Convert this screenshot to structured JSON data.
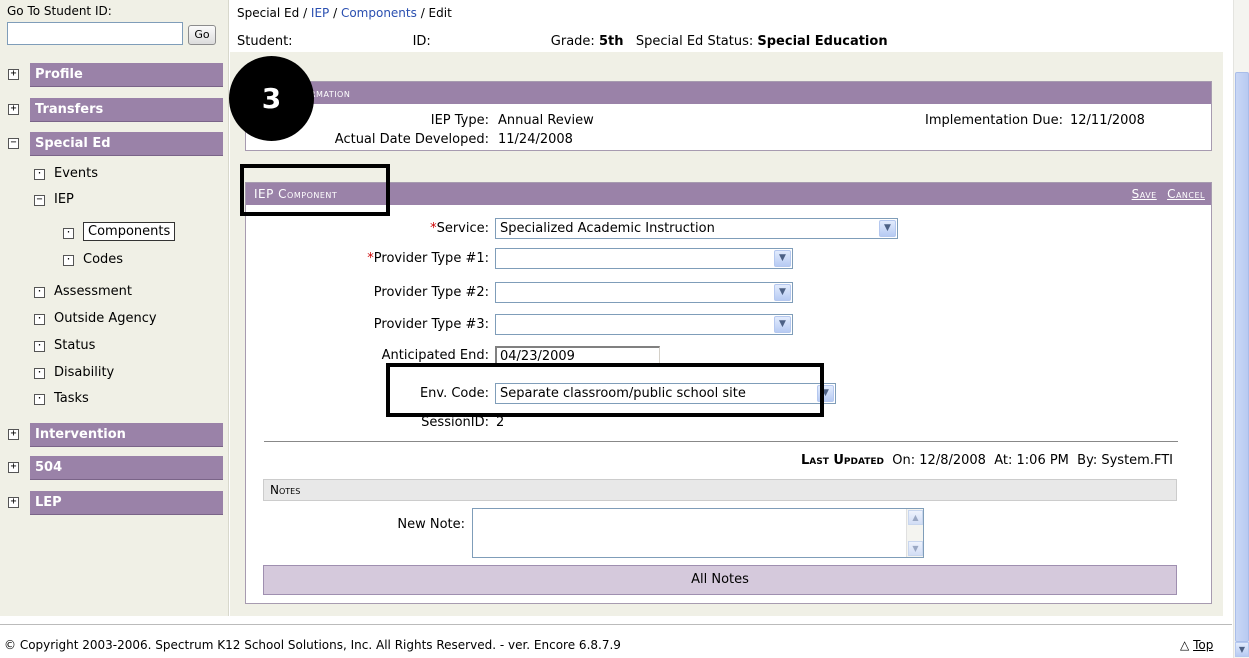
{
  "sidebar": {
    "goto_label": "Go To Student ID:",
    "goto_value": "",
    "go_button": "Go",
    "sections": [
      {
        "label": "Profile",
        "toggle": "+"
      },
      {
        "label": "Transfers",
        "toggle": "+"
      },
      {
        "label": "Special Ed",
        "toggle": "−"
      },
      {
        "label": "Intervention",
        "toggle": "+"
      },
      {
        "label": "504",
        "toggle": "+"
      },
      {
        "label": "LEP",
        "toggle": "+"
      }
    ],
    "special_ed_items": [
      {
        "label": "Events",
        "toggle": "·"
      },
      {
        "label": "IEP",
        "toggle": "−"
      },
      {
        "label": "Components",
        "toggle": "·"
      },
      {
        "label": "Codes",
        "toggle": "·"
      },
      {
        "label": "Assessment",
        "toggle": "·"
      },
      {
        "label": "Outside Agency",
        "toggle": "·"
      },
      {
        "label": "Status",
        "toggle": "·"
      },
      {
        "label": "Disability",
        "toggle": "·"
      },
      {
        "label": "Tasks",
        "toggle": "·"
      }
    ]
  },
  "breadcrumb": {
    "part1": "Special Ed",
    "sep": " / ",
    "part2": "IEP",
    "part3": "Components",
    "part4": "Edit"
  },
  "student": {
    "student_label": "Student:",
    "id_label": "ID:",
    "grade_label": "Grade:",
    "grade_value": "5th",
    "status_label": "Special Ed Status:",
    "status_value": "Special Education"
  },
  "info_panel": {
    "title": "Information",
    "title_visible": "rmation",
    "iep_type_label": "IEP Type:",
    "iep_type_value": "Annual Review",
    "impl_due_label": "Implementation Due:",
    "impl_due_value": "12/11/2008",
    "date_dev_label": "Actual Date Developed:",
    "date_dev_value": "11/24/2008"
  },
  "component_panel": {
    "title": "IEP Component",
    "save": "Save",
    "cancel": "Cancel",
    "service_label": "Service:",
    "service_value": "Specialized Academic Instruction",
    "prov1_label": "Provider Type #1:",
    "prov1_value": "",
    "prov2_label": "Provider Type #2:",
    "prov2_value": "",
    "prov3_label": "Provider Type #3:",
    "prov3_value": "",
    "anticipated_label": "Anticipated End:",
    "anticipated_value": "04/23/2009",
    "env_label": "Env. Code:",
    "env_value": "Separate classroom/public school site",
    "session_label": "SessionID:",
    "session_value": "2",
    "last_updated_label": "Last Updated",
    "on_label": "On:",
    "on_value": "12/8/2008",
    "at_label": "At:",
    "at_value": "1:06 PM",
    "by_label": "By:",
    "by_value": "System.FTI",
    "notes_title": "Notes",
    "new_note_label": "New Note:",
    "new_note_value": "",
    "all_notes": "All Notes"
  },
  "badge": "3",
  "footer": {
    "copyright": "© Copyright 2003-2006. Spectrum K12 School Solutions, Inc. All Rights Reserved. - ver.  Encore 6.8.7.9",
    "top_icon": "△",
    "top_label": "Top"
  }
}
